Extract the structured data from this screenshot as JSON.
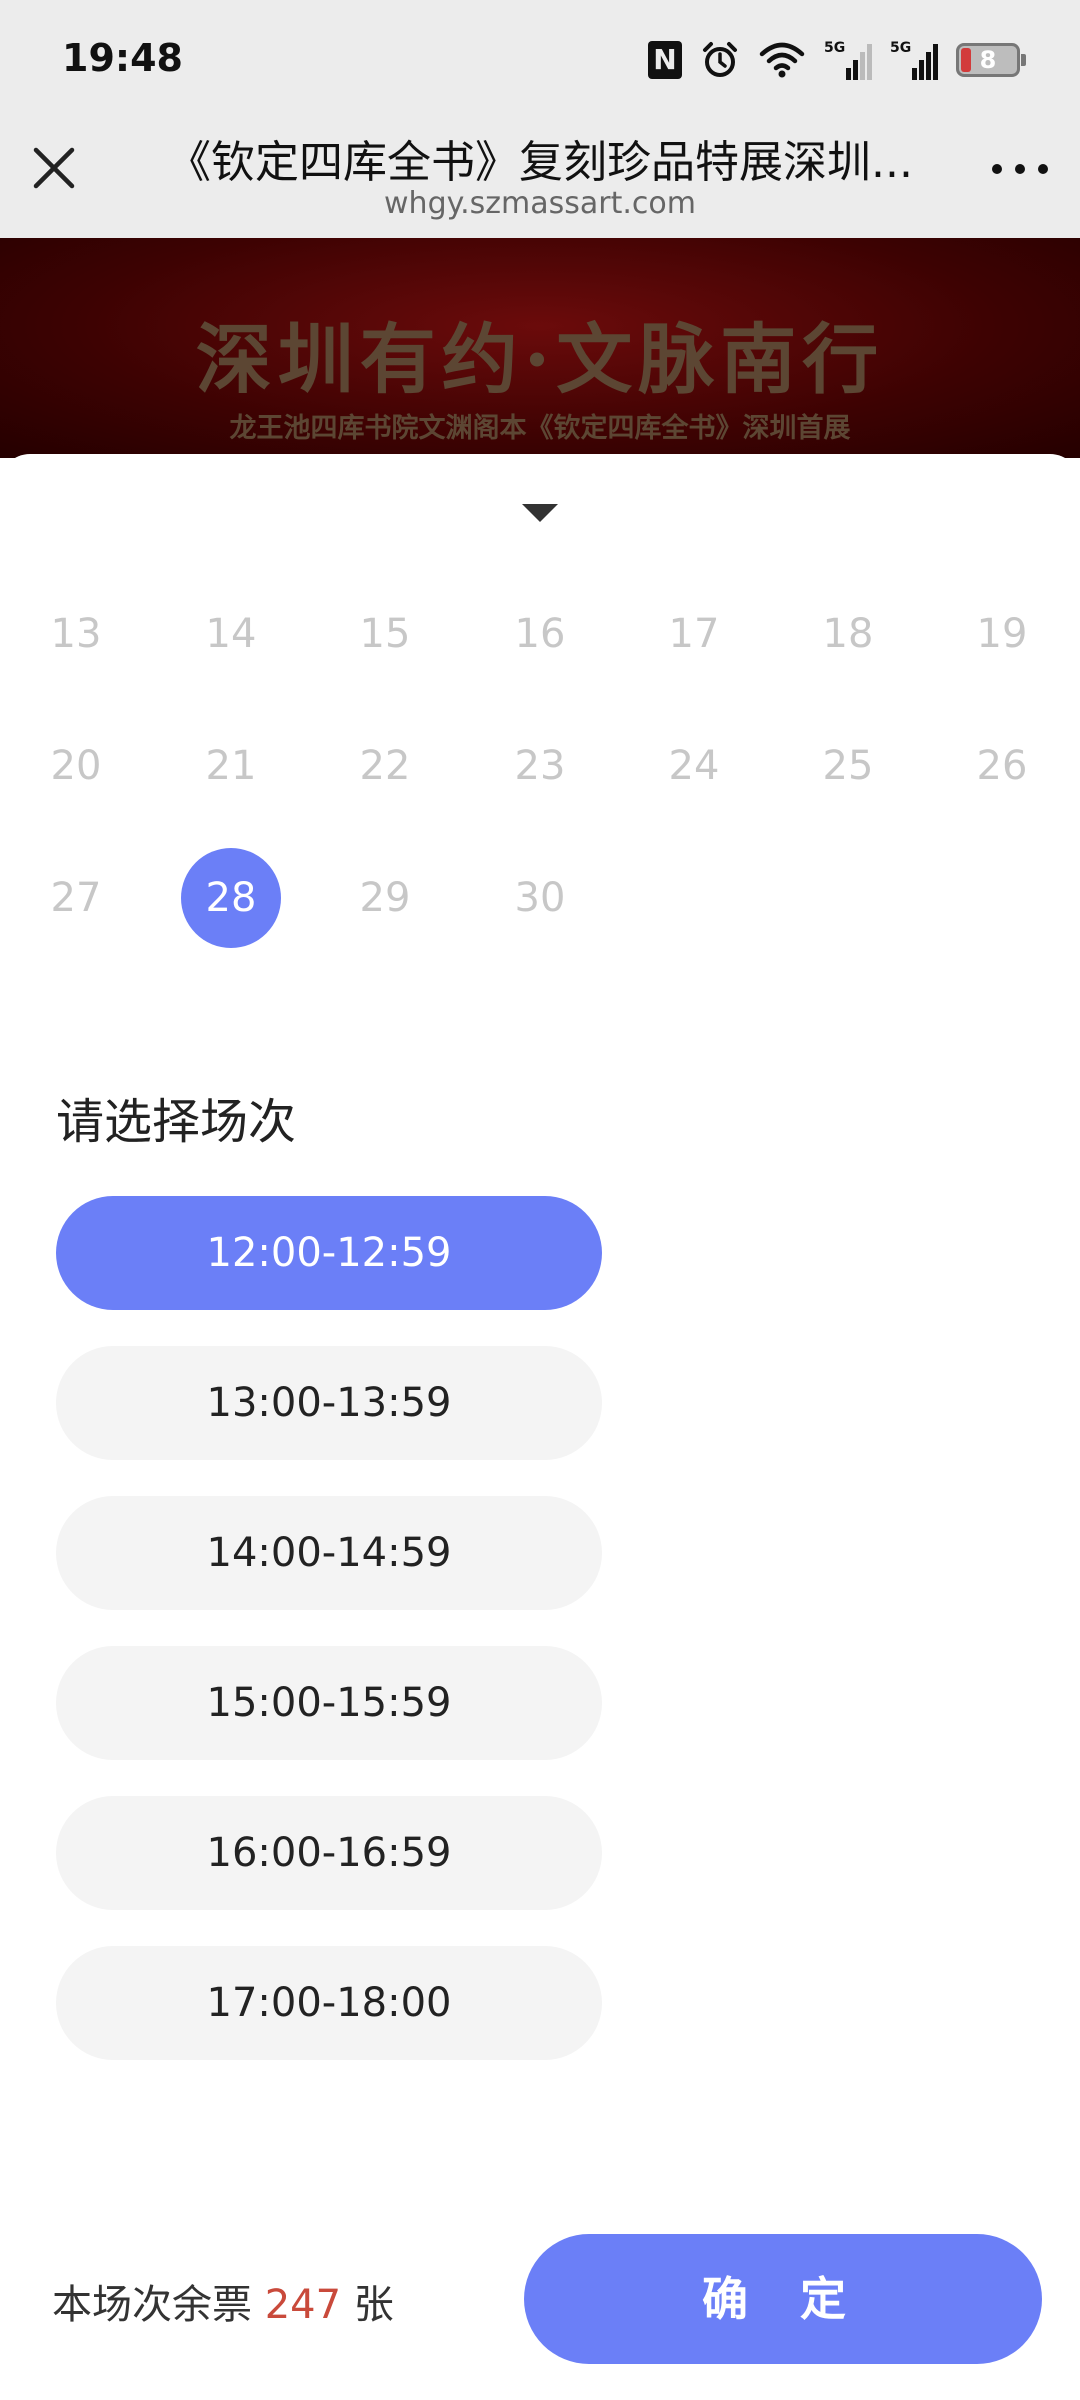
{
  "status_bar": {
    "time": "19:48",
    "battery_level": "8",
    "icons": [
      "nfc-icon",
      "alarm-icon",
      "wifi-icon",
      "signal-5g-icon",
      "signal-5g-icon",
      "battery-icon"
    ]
  },
  "header": {
    "title": "《钦定四库全书》复刻珍品特展深圳...",
    "url": "whgy.szmassart.com",
    "close_icon": "close-icon",
    "more_icon": "more-icon"
  },
  "banner": {
    "title": "深圳有约·文脉南行",
    "subtitle": "龙王池四库书院文渊阁本《钦定四库全书》深圳首展"
  },
  "calendar": {
    "rows": [
      [
        "13",
        "14",
        "15",
        "16",
        "17",
        "18",
        "19"
      ],
      [
        "20",
        "21",
        "22",
        "23",
        "24",
        "25",
        "26"
      ],
      [
        "27",
        "28",
        "29",
        "30"
      ]
    ],
    "selected": "28"
  },
  "session": {
    "title": "请选择场次",
    "slots": [
      {
        "label": "12:00-12:59",
        "selected": true
      },
      {
        "label": "13:00-13:59",
        "selected": false
      },
      {
        "label": "14:00-14:59",
        "selected": false
      },
      {
        "label": "15:00-15:59",
        "selected": false
      },
      {
        "label": "16:00-16:59",
        "selected": false
      },
      {
        "label": "17:00-18:00",
        "selected": false
      }
    ]
  },
  "footer": {
    "remaining_prefix": "本场次余票 ",
    "remaining_count": "247",
    "remaining_suffix": " 张",
    "confirm_label": "确 定"
  },
  "colors": {
    "accent": "#6b7ff7",
    "count_red": "#c94a3b",
    "banner_red": "#3d0202"
  }
}
